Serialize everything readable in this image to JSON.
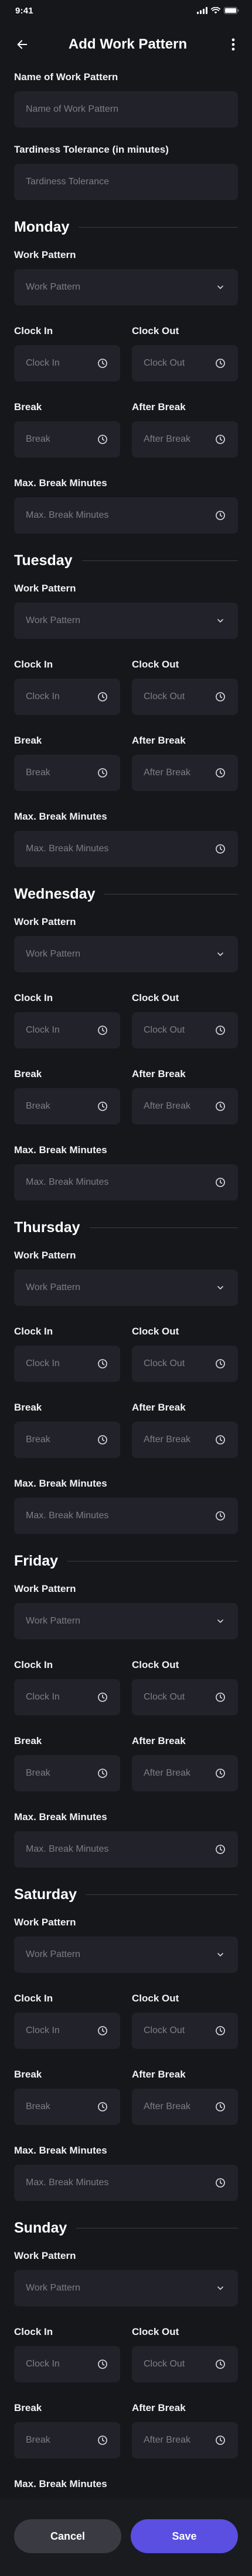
{
  "status_bar": {
    "time": "9:41"
  },
  "header": {
    "title": "Add Work Pattern"
  },
  "name_field": {
    "label": "Name of Work Pattern",
    "placeholder": "Name of Work Pattern"
  },
  "tardiness_field": {
    "label": "Tardiness Tolerance (in minutes)",
    "placeholder": "Tardiness Tolerance"
  },
  "labels": {
    "work_pattern": "Work Pattern",
    "clock_in": "Clock In",
    "clock_out": "Clock Out",
    "break": "Break",
    "after_break": "After Break",
    "max_break": "Max. Break Minutes"
  },
  "placeholders": {
    "work_pattern": "Work Pattern",
    "clock_in": "Clock In",
    "clock_out": "Clock Out",
    "break": "Break",
    "after_break": "After Break",
    "max_break": "Max. Break Minutes"
  },
  "days": [
    {
      "name": "Monday"
    },
    {
      "name": "Tuesday"
    },
    {
      "name": "Wednesday"
    },
    {
      "name": "Thursday"
    },
    {
      "name": "Friday"
    },
    {
      "name": "Saturday"
    },
    {
      "name": "Sunday"
    }
  ],
  "footer": {
    "cancel_label": "Cancel",
    "save_label": "Save"
  },
  "colors": {
    "background": "#16171b",
    "field": "#22232a",
    "primary": "#5a4fe0",
    "secondary": "#3a3b42"
  }
}
